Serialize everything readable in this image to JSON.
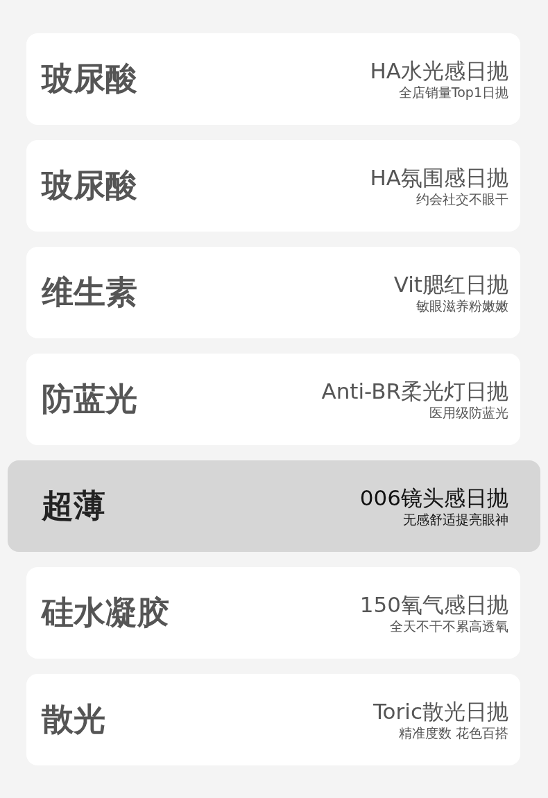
{
  "items": [
    {
      "category": "玻尿酸",
      "product": "HA水光感日抛",
      "tagline": "全店销量Top1日抛",
      "selected": false
    },
    {
      "category": "玻尿酸",
      "product": "HA氛围感日抛",
      "tagline": "约会社交不眼干",
      "selected": false
    },
    {
      "category": "维生素",
      "product": "Vit腮红日抛",
      "tagline": "敏眼滋养粉嫩嫩",
      "selected": false
    },
    {
      "category": "防蓝光",
      "product": "Anti-BR柔光灯日抛",
      "tagline": "医用级防蓝光",
      "selected": false
    },
    {
      "category": "超薄",
      "product": "006镜头感日抛",
      "tagline": "无感舒适提亮眼神",
      "selected": true
    },
    {
      "category": "硅水凝胶",
      "product": "150氧气感日抛",
      "tagline": "全天不干不累高透氧",
      "selected": false
    },
    {
      "category": "散光",
      "product": "Toric散光日抛",
      "tagline": "精准度数 花色百搭",
      "selected": false
    }
  ]
}
